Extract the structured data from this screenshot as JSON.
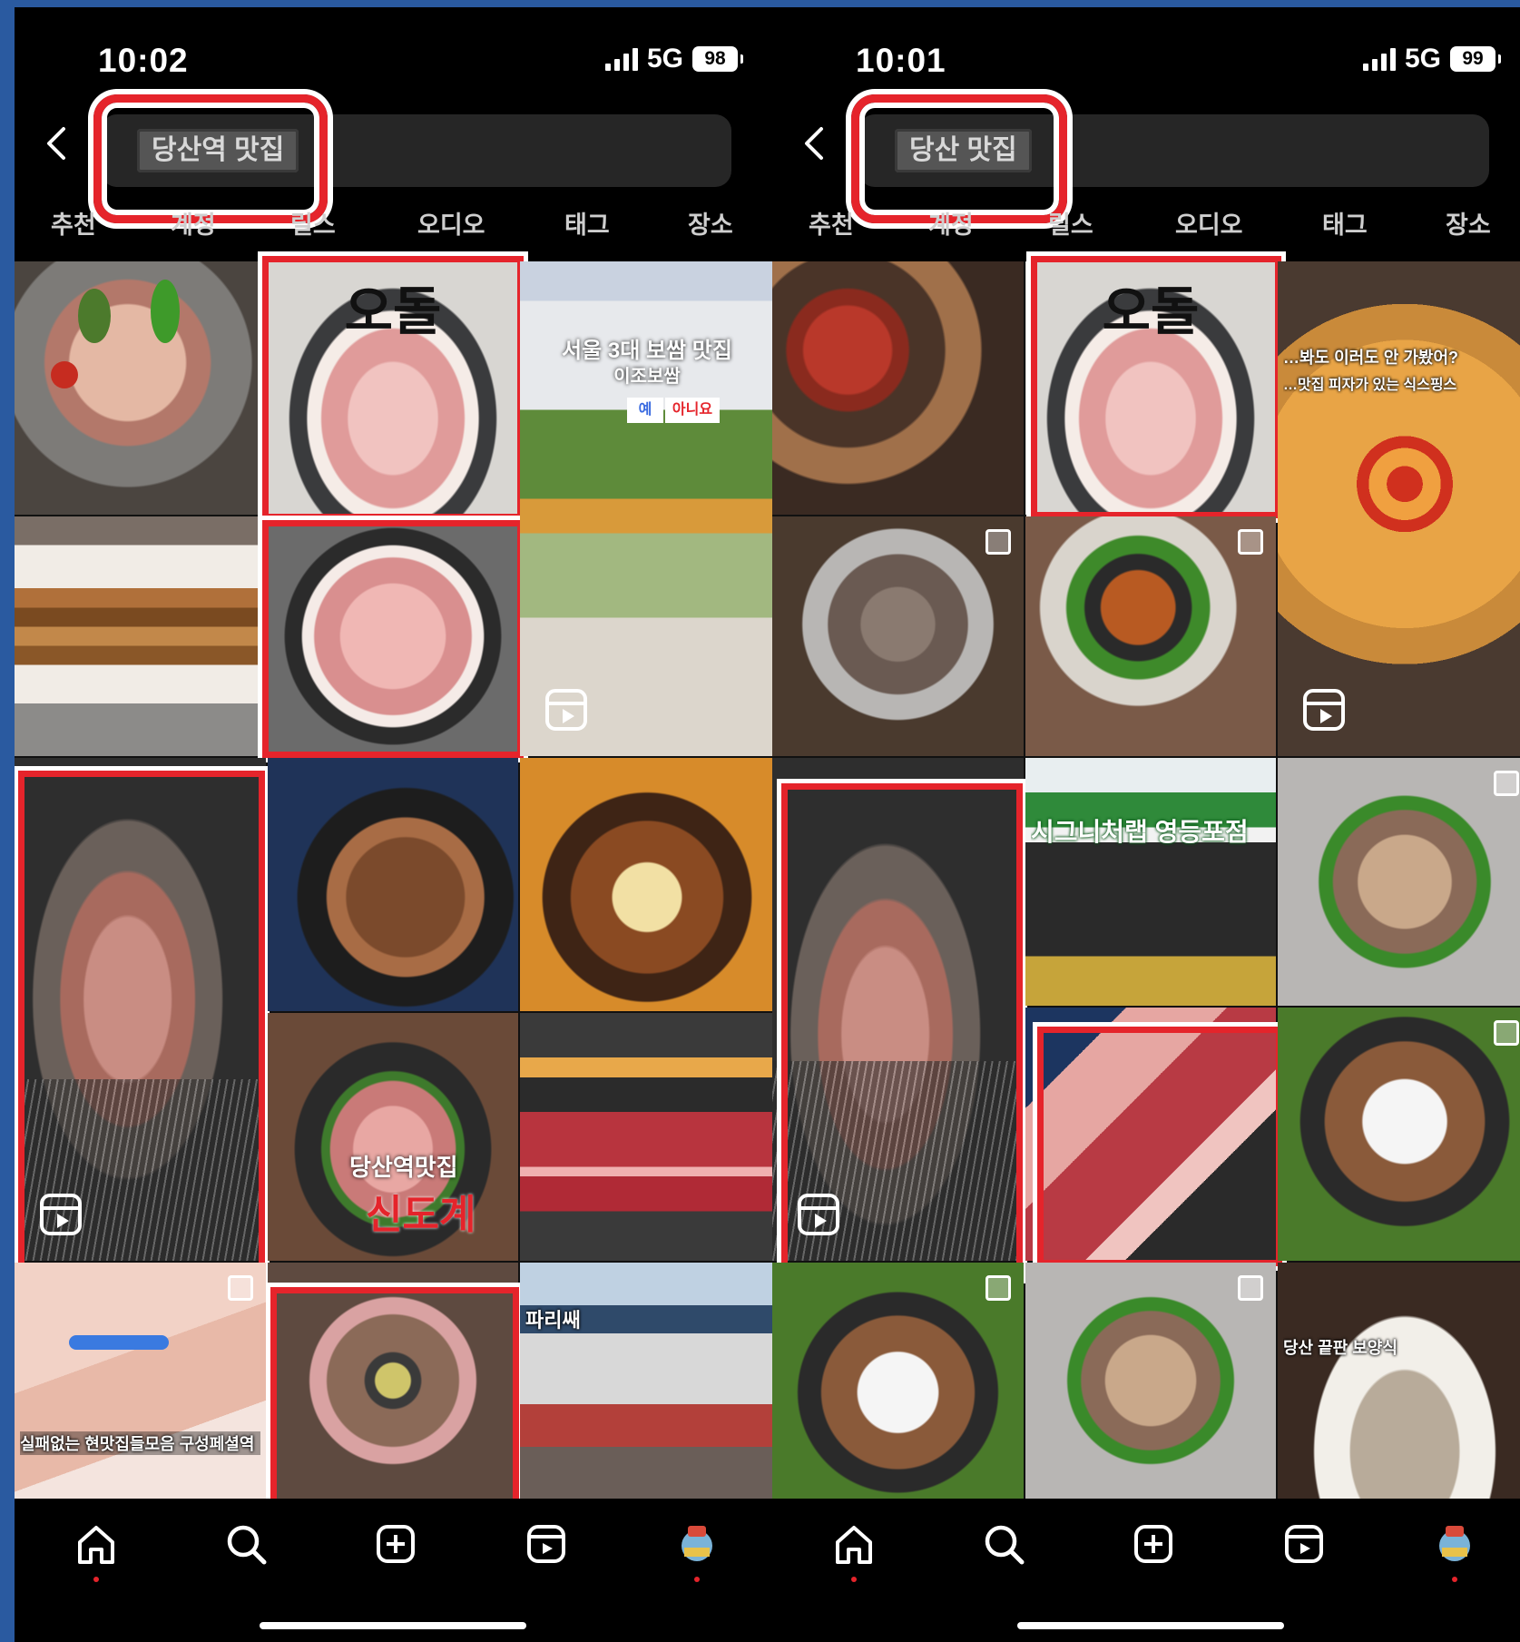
{
  "phones": [
    {
      "time": "10:02",
      "network": "5G",
      "battery": "98",
      "search_query": "당산역 맛집",
      "tabs": [
        "추천",
        "계정",
        "릴스",
        "오디오",
        "태그",
        "장소"
      ],
      "tiles": {
        "t2": {
          "sign": "오돌"
        },
        "t5": {
          "caption": "서울 3대 보쌈 맛집",
          "caption2": "이조보쌈",
          "badge1": "예",
          "badge2": "아니요"
        },
        "t10": {
          "caption": "당산역맛집",
          "caption2": "신도계"
        },
        "t12": {
          "caption": "실패없는 현맛집들모음 구성페셜역"
        },
        "t14": {
          "caption": "파리쌔"
        }
      }
    },
    {
      "time": "10:01",
      "network": "5G",
      "battery": "99",
      "search_query": "당산 맛집",
      "tabs": [
        "추천",
        "계정",
        "릴스",
        "오디오",
        "태그",
        "장소"
      ],
      "tiles": {
        "r2": {
          "sign": "오돌"
        },
        "r3": {
          "caption": "…봐도 이러도 안 가봤어?",
          "caption2": "…맛집 피자가 있는 식스핑스"
        },
        "r8": {
          "caption": "시그니처랩 영등포점"
        },
        "r15": {
          "caption": "당산 끝판 보양식"
        }
      }
    }
  ],
  "nav_icons": [
    "home-icon",
    "search-icon",
    "create-post-icon",
    "reels-icon",
    "profile-avatar"
  ],
  "colors": {
    "highlight": "#e5242b",
    "background": "#000000",
    "tab_text": "#cfcfcf"
  }
}
